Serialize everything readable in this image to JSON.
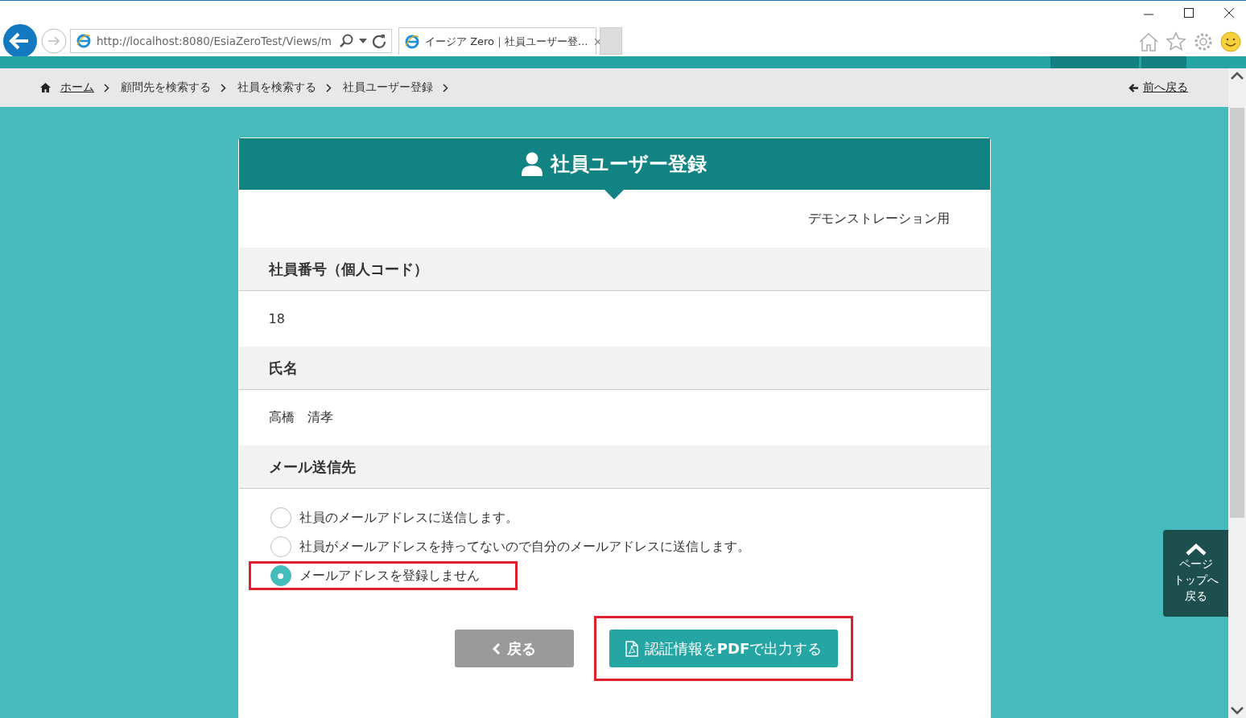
{
  "browser": {
    "url": "http://localhost:8080/EsiaZeroTest/Views/m",
    "tab": {
      "title": "イージア Zero｜社員ユーザー登...",
      "close": "×"
    }
  },
  "breadcrumbs": {
    "items": [
      {
        "label": "ホーム",
        "link": true
      },
      {
        "label": "顧問先を検索する",
        "link": false
      },
      {
        "label": "社員を検索する",
        "link": false
      },
      {
        "label": "社員ユーザー登録",
        "link": false
      }
    ],
    "back_link": "前へ戻る"
  },
  "form": {
    "title": "社員ユーザー登録",
    "note": "デモンストレーション用",
    "fields": [
      {
        "label": "社員番号（個人コード）",
        "value": "18"
      },
      {
        "label": "氏名",
        "value": "高橋　清孝"
      }
    ],
    "mail": {
      "label": "メール送信先",
      "options": [
        {
          "label": "社員のメールアドレスに送信します。",
          "selected": false,
          "highlighted": false
        },
        {
          "label": "社員がメールアドレスを持ってないので自分のメールアドレスに送信します。",
          "selected": false,
          "highlighted": false
        },
        {
          "label": "メールアドレスを登録しません",
          "selected": true,
          "highlighted": true
        }
      ]
    },
    "buttons": [
      {
        "label": "戻る",
        "kind": "back",
        "highlighted": false
      },
      {
        "label": "認証情報を**PDF**で出力する",
        "kind": "pdf",
        "highlighted": true
      }
    ]
  },
  "page_top": {
    "lines": [
      "ページ",
      "トップへ",
      "戻る"
    ]
  }
}
